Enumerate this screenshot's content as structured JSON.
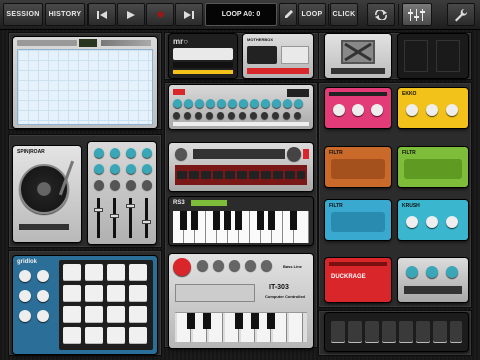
{
  "toolbar": {
    "session_label": "SESSION",
    "history_label": "HISTORY",
    "loop_display": "LOOP A0: 0",
    "loop_label": "LOOP",
    "click_label": "CLICK"
  },
  "devices": {
    "spinroar_label": "SPIN|ROAR",
    "mrorb_label": "mr○",
    "synth_label": "RS3",
    "gridlok_label": "gridlok",
    "duckrage_label": "DUCKRAGE",
    "filtr_label_1": "FILTR",
    "filtr_label_2": "FILTR",
    "filtr_label_3": "FILTR",
    "krush_label": "KRUSH",
    "ekko_label": "EKKO",
    "mrbox_label": "MOTHERBOX",
    "tb_label": "IT-303",
    "tb_sub_label": "Computer Controlled",
    "bass_label": "Bass Line"
  },
  "colors": {
    "pink": "#e23b78",
    "yellow": "#f2c21a",
    "orange": "#c9692a",
    "green": "#7ebd3a",
    "blue": "#3aa9cf",
    "cyan": "#3ab7cf",
    "red": "#d8262a",
    "sky": "#e6f2fb",
    "gridlok": "#2b6f98"
  }
}
